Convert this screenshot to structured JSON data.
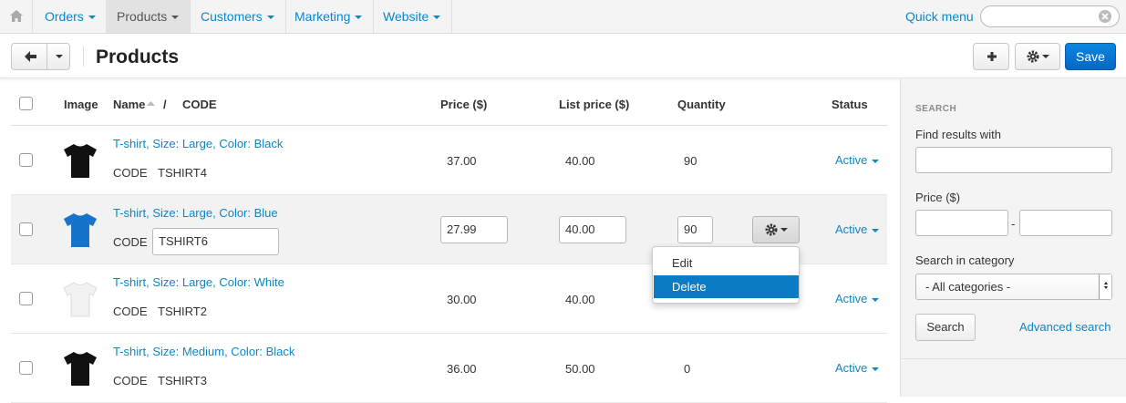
{
  "nav": {
    "items": [
      {
        "label": "Orders"
      },
      {
        "label": "Products"
      },
      {
        "label": "Customers"
      },
      {
        "label": "Marketing"
      },
      {
        "label": "Website"
      }
    ],
    "quick_menu": "Quick menu",
    "search_placeholder": ""
  },
  "header": {
    "title": "Products",
    "save_label": "Save"
  },
  "table": {
    "columns": {
      "image": "Image",
      "name": "Name",
      "slash": "/",
      "code": "CODE",
      "price": "Price ($)",
      "list_price": "List price ($)",
      "quantity": "Quantity",
      "status": "Status"
    },
    "rows": [
      {
        "name": "T-shirt, Size: Large, Color: Black",
        "code_label": "CODE",
        "code": "TSHIRT4",
        "price": "37.00",
        "list_price": "40.00",
        "quantity": "90",
        "status": "Active",
        "color": "#111111"
      },
      {
        "name": "T-shirt, Size: Large, Color: Blue",
        "code_label": "CODE",
        "code": "TSHIRT6",
        "price": "27.99",
        "list_price": "40.00",
        "quantity": "90",
        "status": "Active",
        "color": "#1673c9"
      },
      {
        "name": "T-shirt, Size: Large, Color: White",
        "code_label": "CODE",
        "code": "TSHIRT2",
        "price": "30.00",
        "list_price": "40.00",
        "quantity": "",
        "status": "Active",
        "color": "#f2f2f2"
      },
      {
        "name": "T-shirt, Size: Medium, Color: Black",
        "code_label": "CODE",
        "code": "TSHIRT3",
        "price": "36.00",
        "list_price": "50.00",
        "quantity": "0",
        "status": "Active",
        "color": "#111111"
      }
    ]
  },
  "row_menu": {
    "items": [
      "Edit",
      "Delete"
    ],
    "selected": "Delete"
  },
  "sidebar": {
    "heading": "SEARCH",
    "find_label": "Find results with",
    "find_value": "",
    "price_label": "Price ($)",
    "price_sep": "-",
    "category_label": "Search in category",
    "category_value": "- All categories -",
    "search_button": "Search",
    "advanced_link": "Advanced search"
  },
  "icons": [
    "home-icon",
    "back-arrow-icon",
    "plus-icon",
    "gear-icon",
    "clear-icon",
    "sort-asc-icon"
  ],
  "colors": {
    "link": "#0c86c8",
    "primary_button": "#0a73d1",
    "selected_menu_item": "#0b7bc4"
  }
}
